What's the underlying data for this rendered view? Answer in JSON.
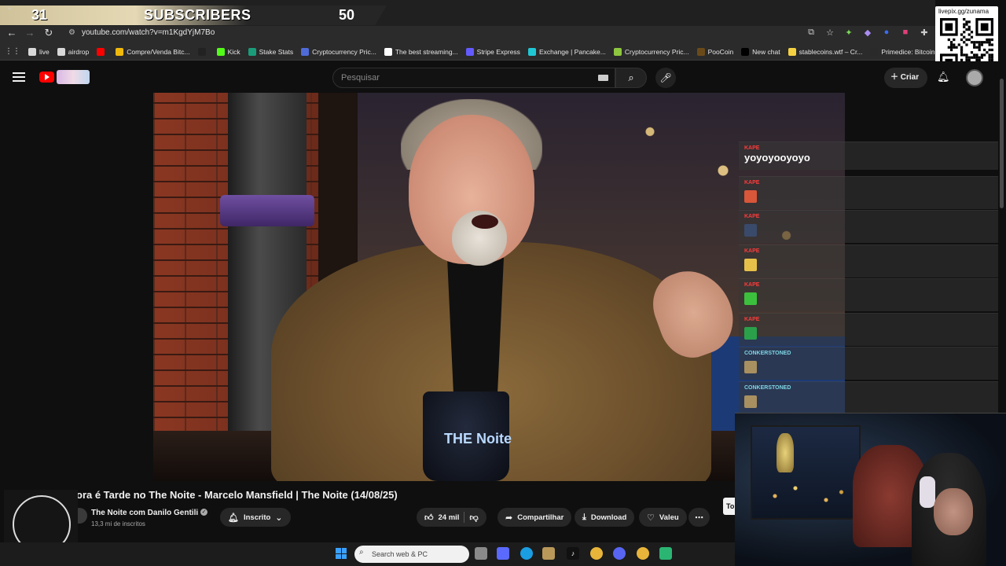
{
  "overlay": {
    "subs_current": "31",
    "subs_label": "SUBSCRIBERS",
    "subs_goal": "50"
  },
  "browser": {
    "url": "youtube.com/watch?v=m1KgdYjM7Bo",
    "bookmarks": [
      {
        "label": "live",
        "color": "#d8d8d8"
      },
      {
        "label": "airdrop",
        "color": "#d8d8d8"
      },
      {
        "label": "",
        "color": "#ff0000"
      },
      {
        "label": "Compre/Venda Bitc...",
        "color": "#f0b90b"
      },
      {
        "label": "",
        "color": "#222222"
      },
      {
        "label": "Kick",
        "color": "#53fc18"
      },
      {
        "label": "Stake Stats",
        "color": "#1a9c7a"
      },
      {
        "label": "Cryptocurrency Pric...",
        "color": "#4f6bd8"
      },
      {
        "label": "The best streaming...",
        "color": "#ffffff"
      },
      {
        "label": "Stripe Express",
        "color": "#635bff"
      },
      {
        "label": "Exchange | Pancake...",
        "color": "#1fc7d4"
      },
      {
        "label": "Cryptocurrency Pric...",
        "color": "#8dc63f"
      },
      {
        "label": "PooCoin",
        "color": "#6b4a1a"
      },
      {
        "label": "New chat",
        "color": "#000000"
      },
      {
        "label": "stablecoins.wtf – Cr...",
        "color": "#f5d142"
      },
      {
        "label": "Primedice: Bitcoin G...",
        "color": "#2a2a2a"
      }
    ]
  },
  "qr": {
    "label": "livepix.gg/zunama"
  },
  "youtube": {
    "search_placeholder": "Pesquisar",
    "create_label": "Criar",
    "video_title": "ora é Tarde no The Noite - Marcelo Mansfield | The Noite (14/08/25)",
    "channel_name": "The Noite com Danilo Gentili",
    "channel_subs": "13,3 mi de inscritos",
    "subscribed_label": "Inscrito",
    "likes": "24 mil",
    "share_label": "Compartilhar",
    "download_label": "Download",
    "thanks_label": "Valeu",
    "side_button": "To",
    "mug_text": "THE Noite"
  },
  "chat": {
    "messages": [
      {
        "name": "KAPE",
        "text": "yoyoyooyoyo",
        "emote_color": "",
        "teal": false
      },
      {
        "name": "KAPE",
        "text": "",
        "emote_color": "#d8563a",
        "teal": false
      },
      {
        "name": "KAPE",
        "text": "",
        "emote_color": "#3a4a6a",
        "teal": false
      },
      {
        "name": "KAPE",
        "text": "",
        "emote_color": "#e6c14a",
        "teal": false
      },
      {
        "name": "KAPE",
        "text": "",
        "emote_color": "#3cbf3c",
        "teal": false
      },
      {
        "name": "KAPE",
        "text": "",
        "emote_color": "#2aa04a",
        "teal": false
      },
      {
        "name": "CONKERSTONED",
        "text": "",
        "emote_color": "#a89060",
        "teal": true
      },
      {
        "name": "CONKERSTONED",
        "text": "",
        "emote_color": "#a89060",
        "teal": true
      }
    ]
  },
  "taskbar": {
    "search_placeholder": "Search web & PC"
  }
}
